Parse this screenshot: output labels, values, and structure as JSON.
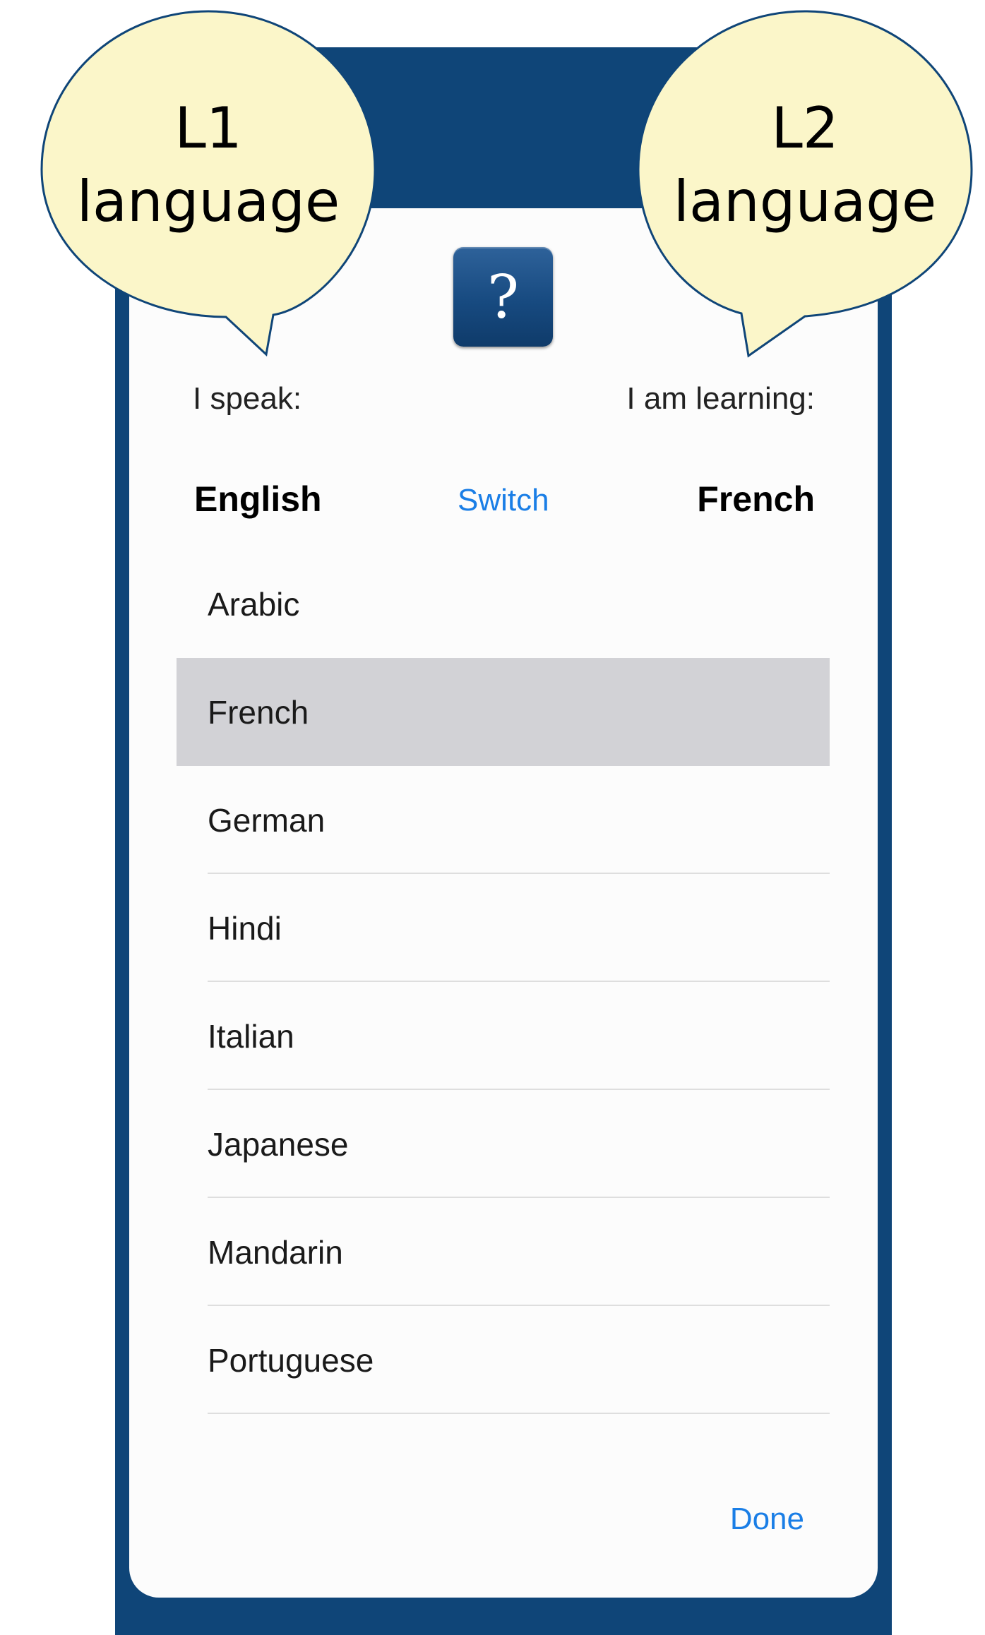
{
  "callouts": {
    "l1": {
      "line1": "L1",
      "line2": "language"
    },
    "l2": {
      "line1": "L2",
      "line2": "language"
    }
  },
  "help_button": {
    "glyph": "?",
    "icon": "question-mark-icon"
  },
  "labels": {
    "speak": "I speak:",
    "learning": "I am learning:"
  },
  "languages": {
    "l1": "English",
    "l2": "French"
  },
  "switch_label": "Switch",
  "list": {
    "items": [
      "Arabic",
      "French",
      "German",
      "Hindi",
      "Italian",
      "Japanese",
      "Mandarin",
      "Portuguese"
    ],
    "selected": "French"
  },
  "done_label": "Done",
  "colors": {
    "frame": "#0f4578",
    "accent": "#1a7ee6",
    "selected_row": "#d2d2d6",
    "callout_fill": "#fbf6c9"
  }
}
